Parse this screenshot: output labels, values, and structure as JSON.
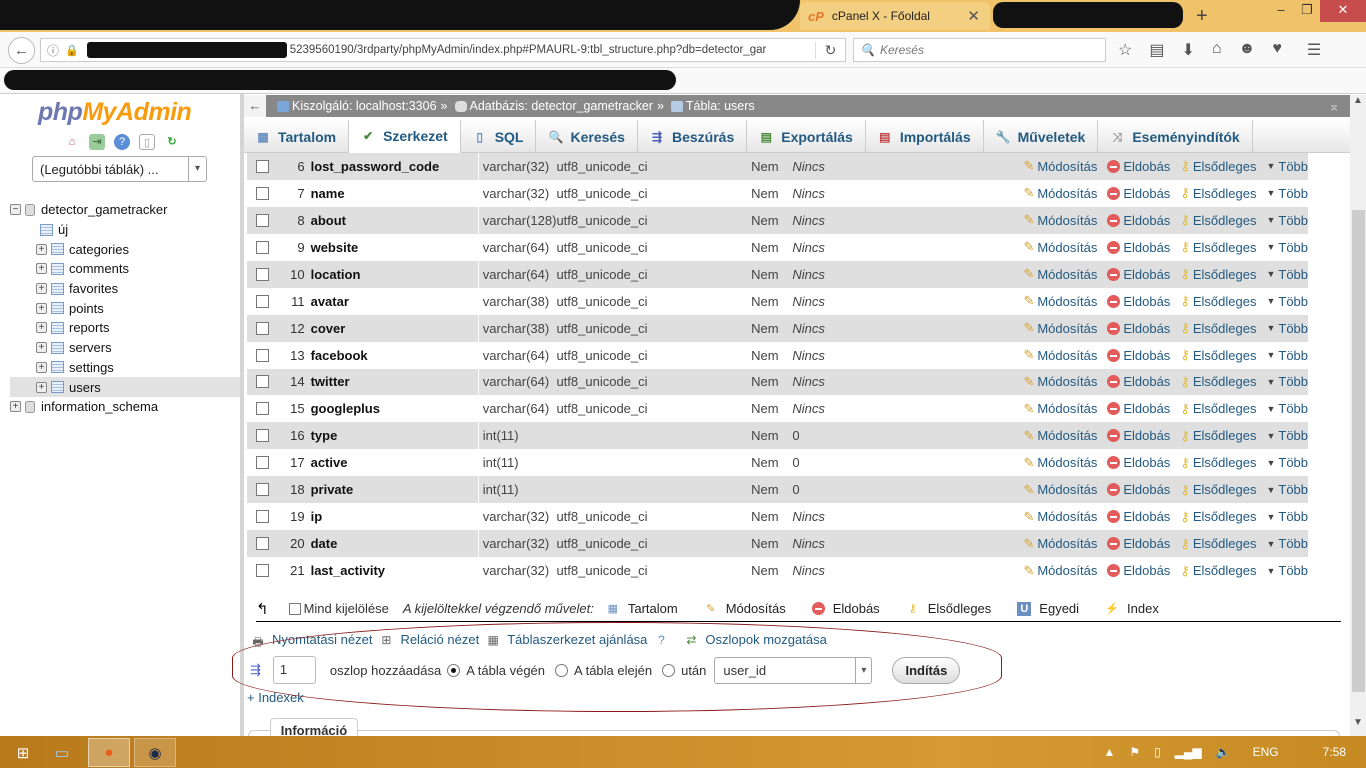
{
  "browser": {
    "active_tab_title": "cPanel X - Főoldal",
    "url_visible": "5239560190/3rdparty/phpMyAdmin/index.php#PMAURL-9:tbl_structure.php?db=detector_gar",
    "search_placeholder": "Keresés"
  },
  "sidebar": {
    "logo_php": "php",
    "logo_myadmin": "MyAdmin",
    "recent_tables": "(Legutóbbi táblák) ...",
    "tree": {
      "db1": "detector_gametracker",
      "new": "új",
      "tables": [
        "categories",
        "comments",
        "favorites",
        "points",
        "reports",
        "servers",
        "settings",
        "users"
      ],
      "selected": "users",
      "db2": "information_schema"
    }
  },
  "breadcrumb": {
    "server": "Kiszolgáló: localhost:3306",
    "database": "Adatbázis: detector_gametracker",
    "table": "Tábla: users",
    "sep": "»"
  },
  "tabs": [
    {
      "label": "Tartalom",
      "icon": "table-icon"
    },
    {
      "label": "Szerkezet",
      "icon": "structure-icon",
      "active": true
    },
    {
      "label": "SQL",
      "icon": "sql-icon"
    },
    {
      "label": "Keresés",
      "icon": "search-icon"
    },
    {
      "label": "Beszúrás",
      "icon": "insert-icon"
    },
    {
      "label": "Exportálás",
      "icon": "export-icon"
    },
    {
      "label": "Importálás",
      "icon": "import-icon"
    },
    {
      "label": "Műveletek",
      "icon": "wrench-icon"
    },
    {
      "label": "Eseményindítók",
      "icon": "triggers-icon"
    }
  ],
  "columns": [
    {
      "n": "6",
      "name": "lost_password_code",
      "type": "varchar(32)",
      "collation": "utf8_unicode_ci",
      "null": "Nem",
      "default": "Nincs"
    },
    {
      "n": "7",
      "name": "name",
      "type": "varchar(32)",
      "collation": "utf8_unicode_ci",
      "null": "Nem",
      "default": "Nincs"
    },
    {
      "n": "8",
      "name": "about",
      "type": "varchar(128)",
      "collation": "utf8_unicode_ci",
      "null": "Nem",
      "default": "Nincs"
    },
    {
      "n": "9",
      "name": "website",
      "type": "varchar(64)",
      "collation": "utf8_unicode_ci",
      "null": "Nem",
      "default": "Nincs"
    },
    {
      "n": "10",
      "name": "location",
      "type": "varchar(64)",
      "collation": "utf8_unicode_ci",
      "null": "Nem",
      "default": "Nincs"
    },
    {
      "n": "11",
      "name": "avatar",
      "type": "varchar(38)",
      "collation": "utf8_unicode_ci",
      "null": "Nem",
      "default": "Nincs"
    },
    {
      "n": "12",
      "name": "cover",
      "type": "varchar(38)",
      "collation": "utf8_unicode_ci",
      "null": "Nem",
      "default": "Nincs"
    },
    {
      "n": "13",
      "name": "facebook",
      "type": "varchar(64)",
      "collation": "utf8_unicode_ci",
      "null": "Nem",
      "default": "Nincs"
    },
    {
      "n": "14",
      "name": "twitter",
      "type": "varchar(64)",
      "collation": "utf8_unicode_ci",
      "null": "Nem",
      "default": "Nincs"
    },
    {
      "n": "15",
      "name": "googleplus",
      "type": "varchar(64)",
      "collation": "utf8_unicode_ci",
      "null": "Nem",
      "default": "Nincs"
    },
    {
      "n": "16",
      "name": "type",
      "type": "int(11)",
      "collation": "",
      "null": "Nem",
      "default": "0"
    },
    {
      "n": "17",
      "name": "active",
      "type": "int(11)",
      "collation": "",
      "null": "Nem",
      "default": "0"
    },
    {
      "n": "18",
      "name": "private",
      "type": "int(11)",
      "collation": "",
      "null": "Nem",
      "default": "0"
    },
    {
      "n": "19",
      "name": "ip",
      "type": "varchar(32)",
      "collation": "utf8_unicode_ci",
      "null": "Nem",
      "default": "Nincs"
    },
    {
      "n": "20",
      "name": "date",
      "type": "varchar(32)",
      "collation": "utf8_unicode_ci",
      "null": "Nem",
      "default": "Nincs"
    },
    {
      "n": "21",
      "name": "last_activity",
      "type": "varchar(32)",
      "collation": "utf8_unicode_ci",
      "null": "Nem",
      "default": "Nincs"
    }
  ],
  "row_actions": {
    "change": "Módosítás",
    "drop": "Eldobás",
    "primary": "Elsődleges",
    "more": "Több"
  },
  "bulk": {
    "select_all": "Mind kijelölése",
    "with_selected": "A kijelöltekkel végzendő művelet:",
    "actions": [
      "Tartalom",
      "Módosítás",
      "Eldobás",
      "Elsődleges",
      "Egyedi",
      "Index"
    ]
  },
  "links": {
    "print": "Nyomtatási nézet",
    "relation": "Reláció nézet",
    "propose": "Táblaszerkezet ajánlása",
    "move": "Oszlopok mozgatása"
  },
  "add_column": {
    "count": "1",
    "label": "oszlop hozzáadása",
    "opt_end": "A tábla végén",
    "opt_begin": "A tábla elején",
    "opt_after": "után",
    "after_field": "user_id",
    "go": "Indítás",
    "selected": "end"
  },
  "indexes_link": "+ Indexek",
  "info_tab": "Információ",
  "taskbar": {
    "lang": "ENG",
    "time": "7:58"
  }
}
